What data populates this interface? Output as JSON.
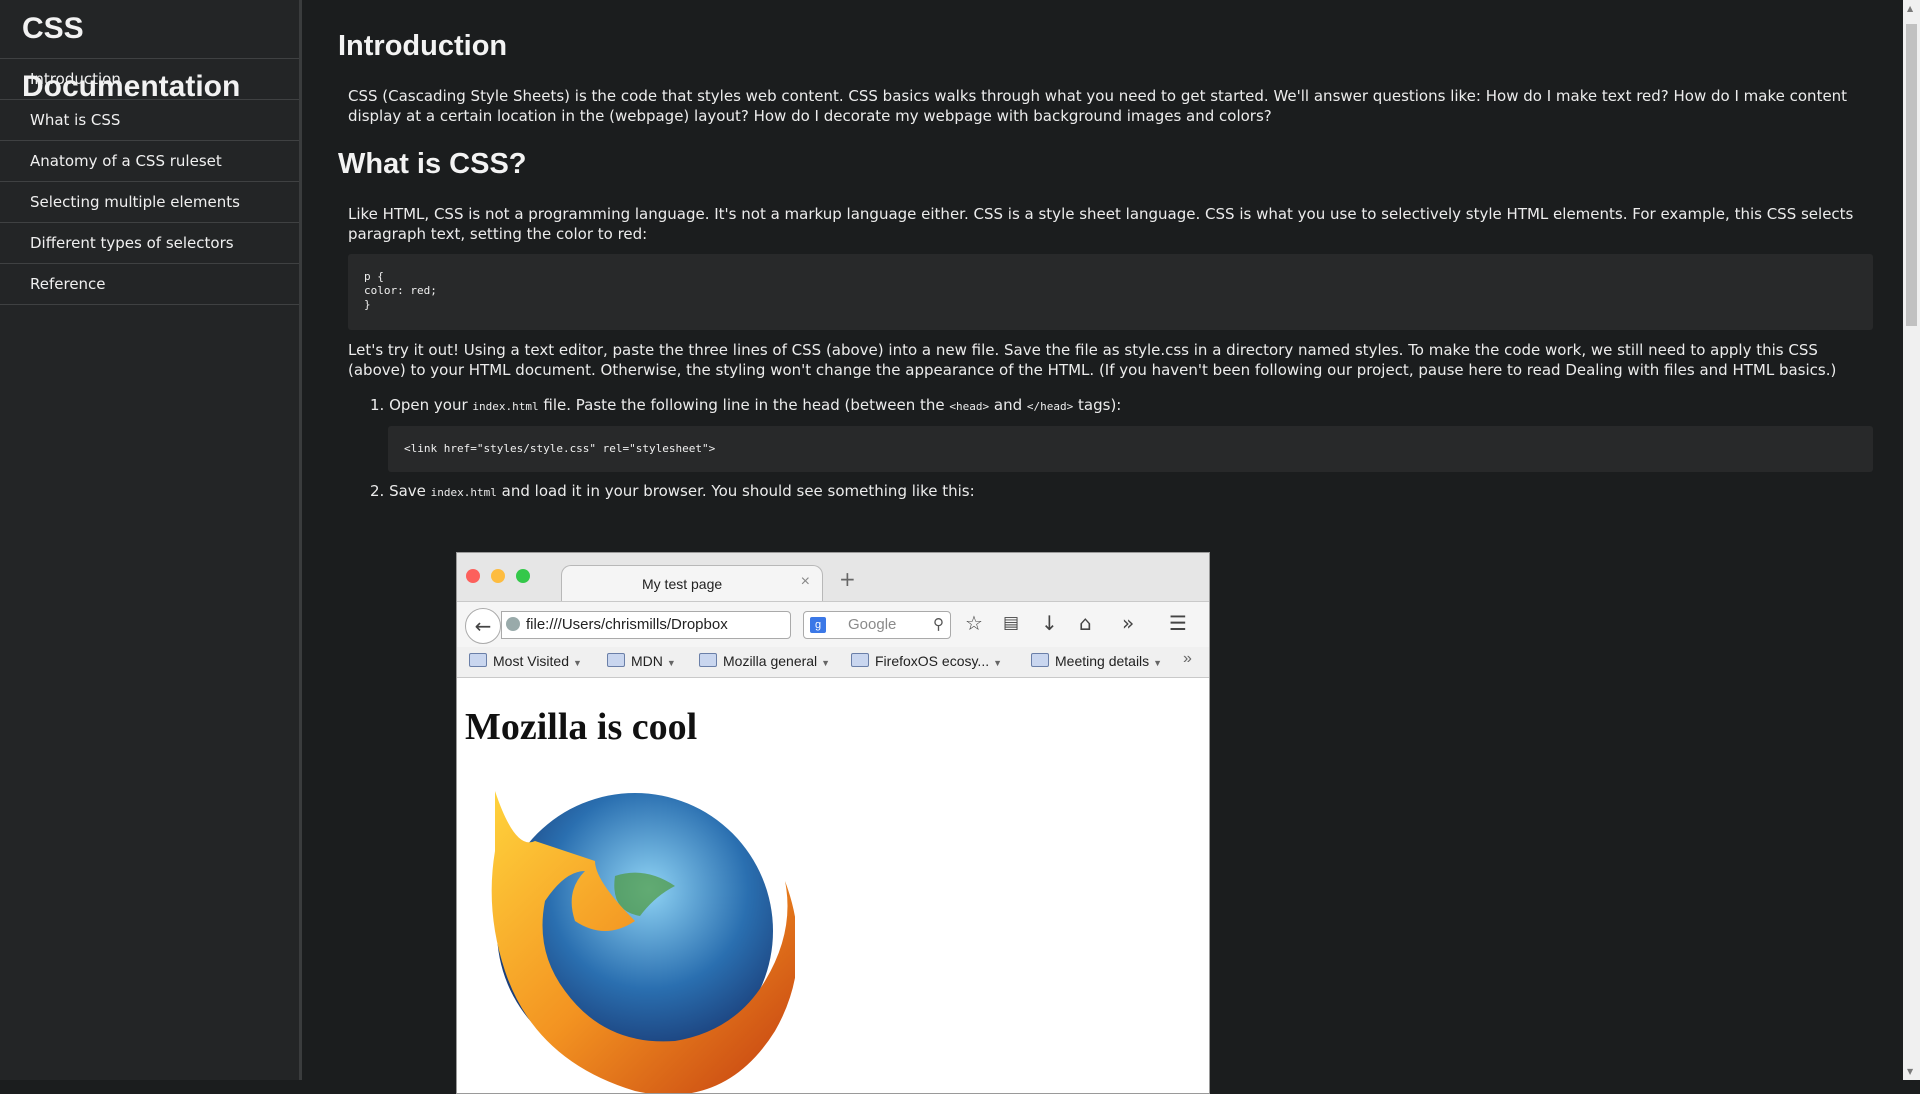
{
  "sidebar": {
    "title": "CSS Documentation",
    "items": [
      {
        "label": "Introduction"
      },
      {
        "label": "What is CSS"
      },
      {
        "label": "Anatomy of a CSS ruleset"
      },
      {
        "label": "Selecting multiple elements"
      },
      {
        "label": "Different types of selectors"
      },
      {
        "label": "Reference"
      }
    ]
  },
  "main": {
    "intro": {
      "heading": "Introduction",
      "text": "CSS (Cascading Style Sheets) is the code that styles web content. CSS basics walks through what you need to get started. We'll answer questions like: How do I make text red? How do I make content display at a certain location in the (webpage) layout? How do I decorate my webpage with background images and colors?"
    },
    "what_is_css": {
      "heading": "What is CSS?",
      "text": "Like HTML, CSS is not a programming language. It's not a markup language either. CSS is a style sheet language. CSS is what you use to selectively style HTML elements. For example, this CSS selects paragraph text, setting the color to red:",
      "code": "p {\ncolor: red;\n}",
      "try_text": "Let's try it out! Using a text editor, paste the three lines of CSS (above) into a new file. Save the file as style.css in a directory named styles. To make the code work, we still need to apply this CSS (above) to your HTML document. Otherwise, the styling won't change the appearance of the HTML. (If you haven't been following our project, pause here to read Dealing with files and HTML basics.)",
      "step1": {
        "prefix": "1. Open your ",
        "code1": "index.html",
        "mid": " file. Paste the following line in the head (between the ",
        "code2": "<head>",
        "and": " and ",
        "code3": "</head>",
        "suffix": " tags):"
      },
      "link_code": "<link href=\"styles/style.css\" rel=\"stylesheet\">",
      "step2": {
        "prefix": "2. Save ",
        "code": "index.html",
        "suffix": " and load it in your browser. You should see something like this:"
      }
    }
  },
  "screenshot": {
    "tab_title": "My test page",
    "tab_close": "×",
    "new_tab": "+",
    "url": "file:///Users/chrismills/Dropbox",
    "search_placeholder": "Google",
    "bookmarks": [
      {
        "label": "Most Visited"
      },
      {
        "label": "MDN"
      },
      {
        "label": "Mozilla general"
      },
      {
        "label": "FirefoxOS ecosy..."
      },
      {
        "label": "Meeting details"
      }
    ],
    "overflow": "»",
    "page_heading": "Mozilla is cool",
    "colors": {
      "close": "#fc605c",
      "minimize": "#fdbc40",
      "zoom": "#34c84a"
    }
  },
  "icons": {
    "back": "back-arrow-icon",
    "reload": "reload-icon",
    "star": "star-icon",
    "reading_list": "clipboard-icon",
    "download": "download-icon",
    "home": "home-icon",
    "more": "double-chevron-icon",
    "menu": "hamburger-icon"
  }
}
